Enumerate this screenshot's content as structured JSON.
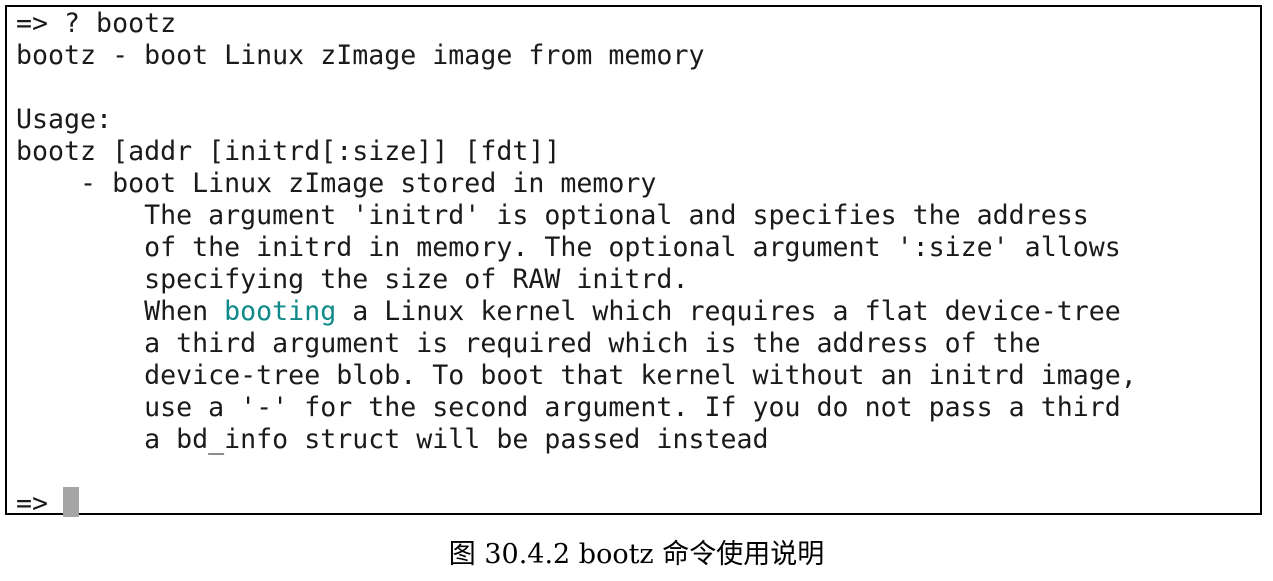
{
  "terminal": {
    "lines": [
      "=> ? bootz",
      "bootz - boot Linux zImage image from memory",
      "",
      "Usage:",
      "bootz [addr [initrd[:size]] [fdt]]",
      "    - boot Linux zImage stored in memory",
      "        The argument 'initrd' is optional and specifies the address",
      "        of the initrd in memory. The optional argument ':size' allows",
      "        specifying the size of RAW initrd.",
      "",
      "        a third argument is required which is the address of the",
      "        device-tree blob. To boot that kernel without an initrd image,",
      "        use a '-' for the second argument. If you do not pass a third",
      "        a bd_info struct will be passed instead",
      "",
      "=> "
    ],
    "line9_parts": {
      "before": "        When ",
      "highlight": "booting",
      "after": " a Linux kernel which requires a flat device-tree"
    },
    "highlight_color": "#0f8a8a",
    "cursor_icon": "block-cursor"
  },
  "caption": {
    "text": "图 30.4.2 bootz 命令使用说明"
  }
}
